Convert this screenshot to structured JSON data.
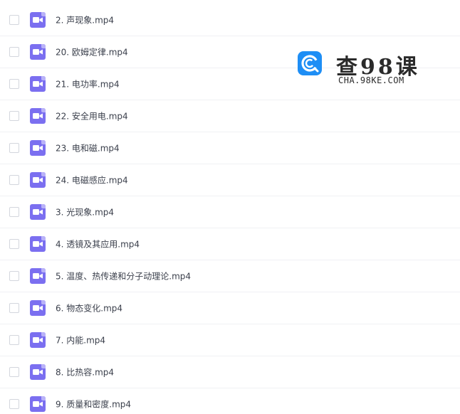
{
  "colors": {
    "video_icon": "#7b6ff0",
    "logo_blue": "#1e8ef5",
    "text": "#3a3f4b"
  },
  "file_icon": "video-file-icon",
  "files": [
    "2. 声现象.mp4",
    "20. 欧姆定律.mp4",
    "21. 电功率.mp4",
    "22. 安全用电.mp4",
    "23. 电和磁.mp4",
    "24. 电磁感应.mp4",
    "3. 光现象.mp4",
    "4. 透镜及其应用.mp4",
    "5. 温度、热传递和分子动理论.mp4",
    "6. 物态变化.mp4",
    "7. 内能.mp4",
    "8. 比热容.mp4",
    "9. 质量和密度.mp4"
  ],
  "watermark": {
    "title": "查98课",
    "subtitle": "CHA.98KE.COM"
  }
}
